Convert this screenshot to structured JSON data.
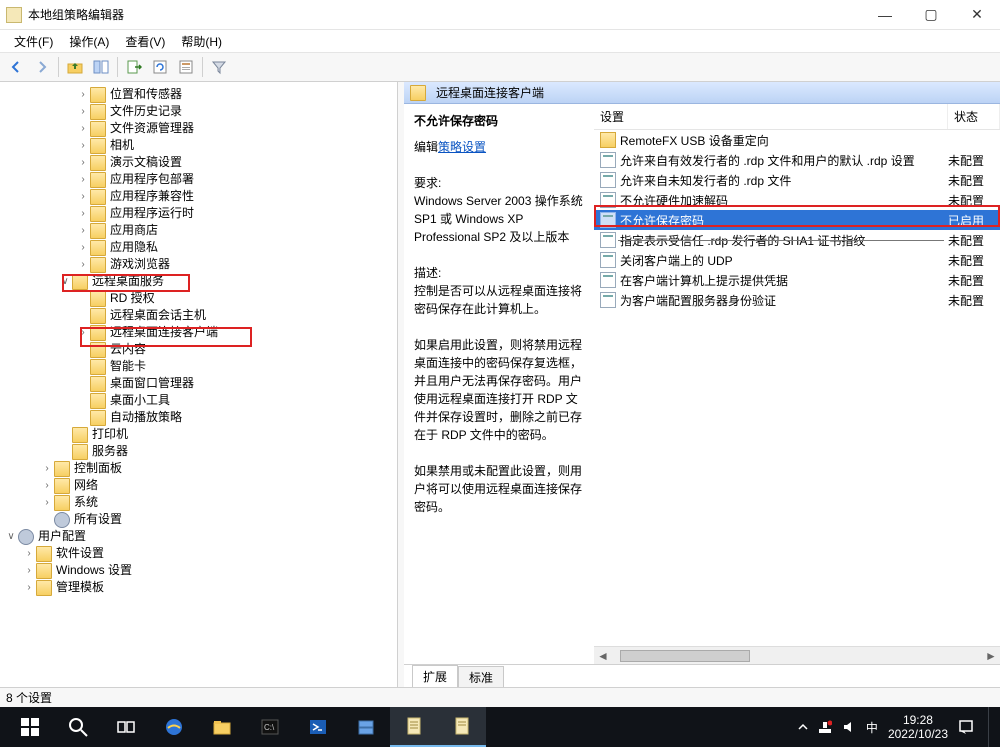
{
  "window": {
    "title": "本地组策略编辑器",
    "min_icon": "—",
    "max_icon": "▢",
    "close_icon": "✕"
  },
  "menus": [
    "文件(F)",
    "操作(A)",
    "查看(V)",
    "帮助(H)"
  ],
  "tree_top": [
    "位置和传感器",
    "文件历史记录",
    "文件资源管理器",
    "相机",
    "演示文稿设置",
    "应用程序包部署",
    "应用程序兼容性",
    "应用程序运行时",
    "应用商店",
    "应用隐私",
    "游戏浏览器"
  ],
  "tree_rds": {
    "label": "远程桌面服务",
    "children": [
      "RD 授权",
      "远程桌面会话主机",
      "远程桌面连接客户端"
    ]
  },
  "tree_mid": [
    "云内容",
    "智能卡",
    "桌面窗口管理器",
    "桌面小工具",
    "自动播放策略"
  ],
  "tree_bottom_simple": [
    "打印机",
    "服务器"
  ],
  "tree_bottom_exp": [
    "控制面板",
    "网络",
    "系统",
    "所有设置"
  ],
  "user_cfg": {
    "label": "用户配置",
    "children": [
      "软件设置",
      "Windows 设置",
      "管理模板"
    ]
  },
  "right": {
    "header": "远程桌面连接客户端",
    "desc_title": "不允许保存密码",
    "edit_prefix": "编辑",
    "edit_link": "策略设置",
    "req_label": "要求:",
    "req_body": "Windows Server 2003 操作系统 SP1 或 Windows XP Professional SP2 及以上版本",
    "desc_label": "描述:",
    "desc_body1": "控制是否可以从远程桌面连接将密码保存在此计算机上。",
    "desc_body2": "如果启用此设置，则将禁用远程桌面连接中的密码保存复选框，并且用户无法再保存密码。用户使用远程桌面连接打开 RDP 文件并保存设置时，删除之前已存在于 RDP 文件中的密码。",
    "desc_body3": "如果禁用或未配置此设置，则用户将可以使用远程桌面连接保存密码。",
    "cols": {
      "name": "设置",
      "state": "状态"
    },
    "items": [
      {
        "type": "folder",
        "name": "RemoteFX USB 设备重定向",
        "state": ""
      },
      {
        "type": "setting",
        "name": "允许来自有效发行者的 .rdp 文件和用户的默认 .rdp 设置",
        "state": "未配置"
      },
      {
        "type": "setting",
        "name": "允许来自未知发行者的 .rdp 文件",
        "state": "未配置"
      },
      {
        "type": "setting",
        "name": "不允许硬件加速解码",
        "state": "未配置"
      },
      {
        "type": "setting",
        "name": "不允许保存密码",
        "state": "已启用",
        "sel": true
      },
      {
        "type": "setting",
        "name": "指定表示受信任 .rdp 发行者的 SHA1 证书指纹",
        "state": "未配置",
        "struck": true
      },
      {
        "type": "setting",
        "name": "关闭客户端上的 UDP",
        "state": "未配置"
      },
      {
        "type": "setting",
        "name": "在客户端计算机上提示提供凭据",
        "state": "未配置"
      },
      {
        "type": "setting",
        "name": "为客户端配置服务器身份验证",
        "state": "未配置"
      }
    ],
    "tabs": [
      "扩展",
      "标准"
    ]
  },
  "status": "8 个设置",
  "tray": {
    "ime": "中",
    "time": "19:28",
    "date": "2022/10/23"
  }
}
